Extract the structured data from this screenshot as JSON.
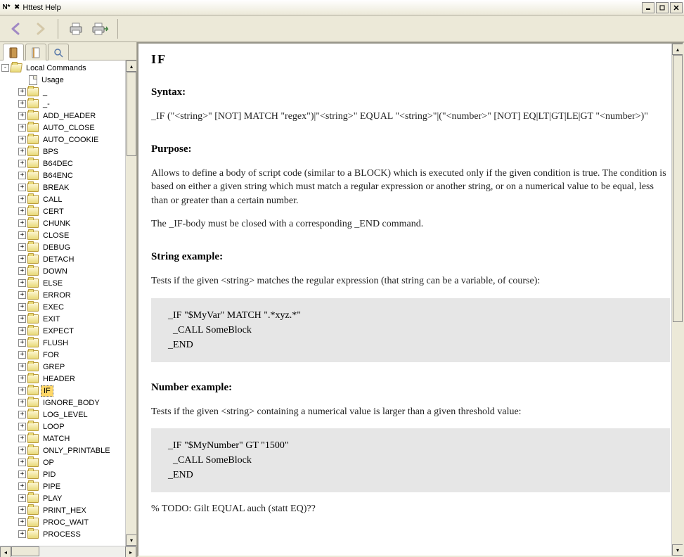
{
  "window": {
    "app_icon_text": "N*",
    "title": "Httest Help"
  },
  "toolbar": {
    "back": "back-icon",
    "forward": "forward-icon",
    "print": "print-icon",
    "print_preview": "print-preview-icon"
  },
  "sidebar": {
    "root_label": "Local Commands",
    "usage_label": "Usage",
    "items": [
      "_",
      "_-",
      "ADD_HEADER",
      "AUTO_CLOSE",
      "AUTO_COOKIE",
      "BPS",
      "B64DEC",
      "B64ENC",
      "BREAK",
      "CALL",
      "CERT",
      "CHUNK",
      "CLOSE",
      "DEBUG",
      "DETACH",
      "DOWN",
      "ELSE",
      "ERROR",
      "EXEC",
      "EXIT",
      "EXPECT",
      "FLUSH",
      "FOR",
      "GREP",
      "HEADER",
      "IF",
      "IGNORE_BODY",
      "LOG_LEVEL",
      "LOOP",
      "MATCH",
      "ONLY_PRINTABLE",
      "OP",
      "PID",
      "PIPE",
      "PLAY",
      "PRINT_HEX",
      "PROC_WAIT",
      "PROCESS"
    ],
    "selected_index": 25
  },
  "help": {
    "title": "IF",
    "syntax_h": "Syntax:",
    "syntax_body": "_IF (\"<string>\" [NOT] MATCH \"regex\")|\"<string>\"  EQUAL \"<string>\"|(\"<number>\" [NOT] EQ|LT|GT|LE|GT \"<number>)\"",
    "purpose_h": "Purpose:",
    "purpose_p1": "Allows to define a body of script code (similar to a BLOCK) which is executed only if the given condition is true. The condition is based on either a given string which must match a regular expression or another string, or on a numerical value to be equal, less than or greater than a certain number.",
    "purpose_p2": "The _IF-body must be closed with a corresponding _END command.",
    "string_ex_h": "String example:",
    "string_ex_p": "Tests if the given <string> matches the regular expression (that string can be a variable, of course):",
    "string_ex_code": "_IF \"$MyVar\" MATCH \".*xyz.*\"\n  _CALL SomeBlock\n_END",
    "number_ex_h": "Number example:",
    "number_ex_p": "Tests if the given <string> containing a numerical value is larger than a given threshold value:",
    "number_ex_code": "_IF \"$MyNumber\" GT \"1500\"\n  _CALL SomeBlock\n_END",
    "todo": "% TODO: Gilt EQUAL auch (statt EQ)??"
  }
}
